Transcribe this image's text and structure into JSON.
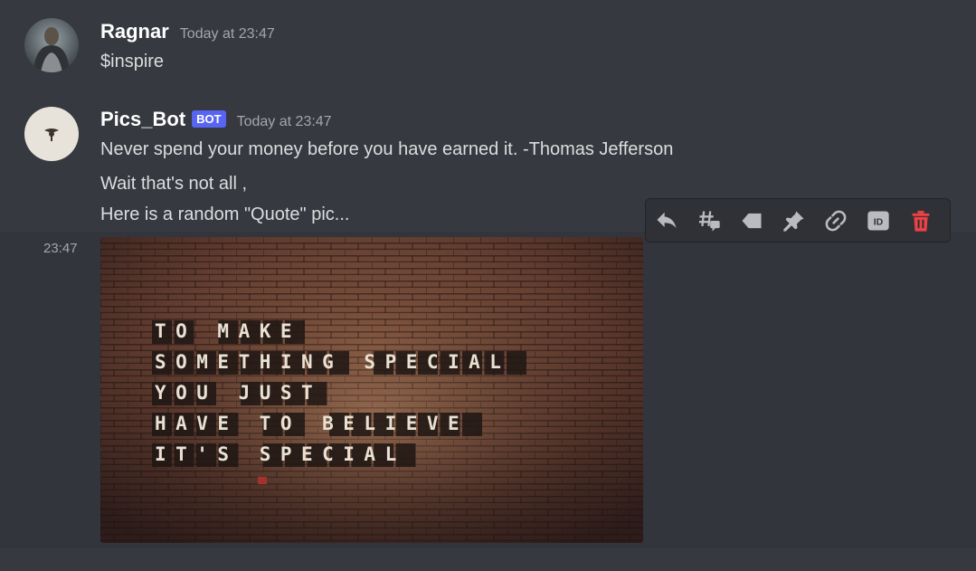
{
  "messages": [
    {
      "author": "Ragnar",
      "time": "Today at 23:47",
      "lines": [
        "$inspire"
      ]
    },
    {
      "author": "Pics_Bot",
      "badge": "BOT",
      "time": "Today at 23:47",
      "lines": [
        "Never spend your money before you have earned it. -Thomas Jefferson",
        "Wait that's not all ,",
        "Here is a random \"Quote\" pic..."
      ],
      "side_time": "23:47",
      "image_text": [
        "TO MAKE",
        "SOMETHING SPECIAL",
        "YOU JUST",
        "HAVE TO BELIEVE",
        "IT'S SPECIAL"
      ]
    }
  ],
  "toolbar": {
    "icons": [
      "reply-icon",
      "thread-icon",
      "tag-icon",
      "pin-icon",
      "link-icon",
      "id-icon",
      "delete-icon"
    ],
    "id_label": "ID",
    "colors": {
      "default": "#b9bbbe",
      "danger": "#ed4245"
    }
  },
  "colors": {
    "background": "#36393f",
    "hover": "#32353b",
    "bot_badge": "#5865f2"
  }
}
